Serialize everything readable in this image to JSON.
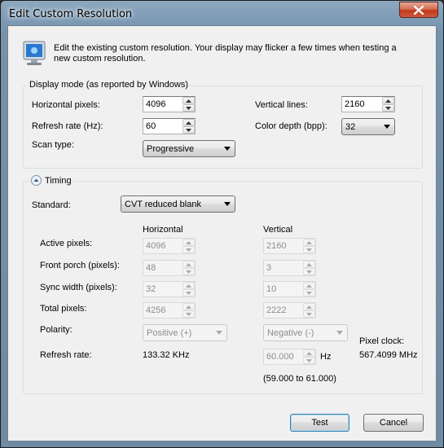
{
  "window": {
    "title": "Edit Custom Resolution"
  },
  "intro": {
    "text": "Edit the existing custom resolution. Your display may flicker a few times when testing a new custom resolution.",
    "icon": "monitor-icon"
  },
  "display_mode": {
    "group_title": "Display mode (as reported by Windows)",
    "horizontal_pixels_label": "Horizontal pixels:",
    "horizontal_pixels_value": "4096",
    "vertical_lines_label": "Vertical lines:",
    "vertical_lines_value": "2160",
    "refresh_rate_label": "Refresh rate (Hz):",
    "refresh_rate_value": "60",
    "color_depth_label": "Color depth (bpp):",
    "color_depth_value": "32",
    "scan_type_label": "Scan type:",
    "scan_type_value": "Progressive"
  },
  "timing": {
    "group_title": "Timing",
    "standard_label": "Standard:",
    "standard_value": "CVT reduced blank",
    "horizontal_header": "Horizontal",
    "vertical_header": "Vertical",
    "rows": [
      {
        "label": "Active pixels:",
        "h": "4096",
        "v": "2160"
      },
      {
        "label": "Front porch (pixels):",
        "h": "48",
        "v": "3"
      },
      {
        "label": "Sync width (pixels):",
        "h": "32",
        "v": "10"
      },
      {
        "label": "Total pixels:",
        "h": "4256",
        "v": "2222"
      }
    ],
    "polarity_label": "Polarity:",
    "polarity_h": "Positive (+)",
    "polarity_v": "Negative (-)",
    "refresh_label": "Refresh rate:",
    "refresh_h": "133.32 KHz",
    "refresh_v": "60.000",
    "refresh_v_unit": "Hz",
    "refresh_range": "(59.000 to 61.000)",
    "pixel_clock_label": "Pixel clock:",
    "pixel_clock_value": "567.4099 MHz"
  },
  "buttons": {
    "test": "Test",
    "cancel": "Cancel"
  },
  "colors": {
    "close": "#c0391b",
    "accent": "#3c7fb1"
  }
}
